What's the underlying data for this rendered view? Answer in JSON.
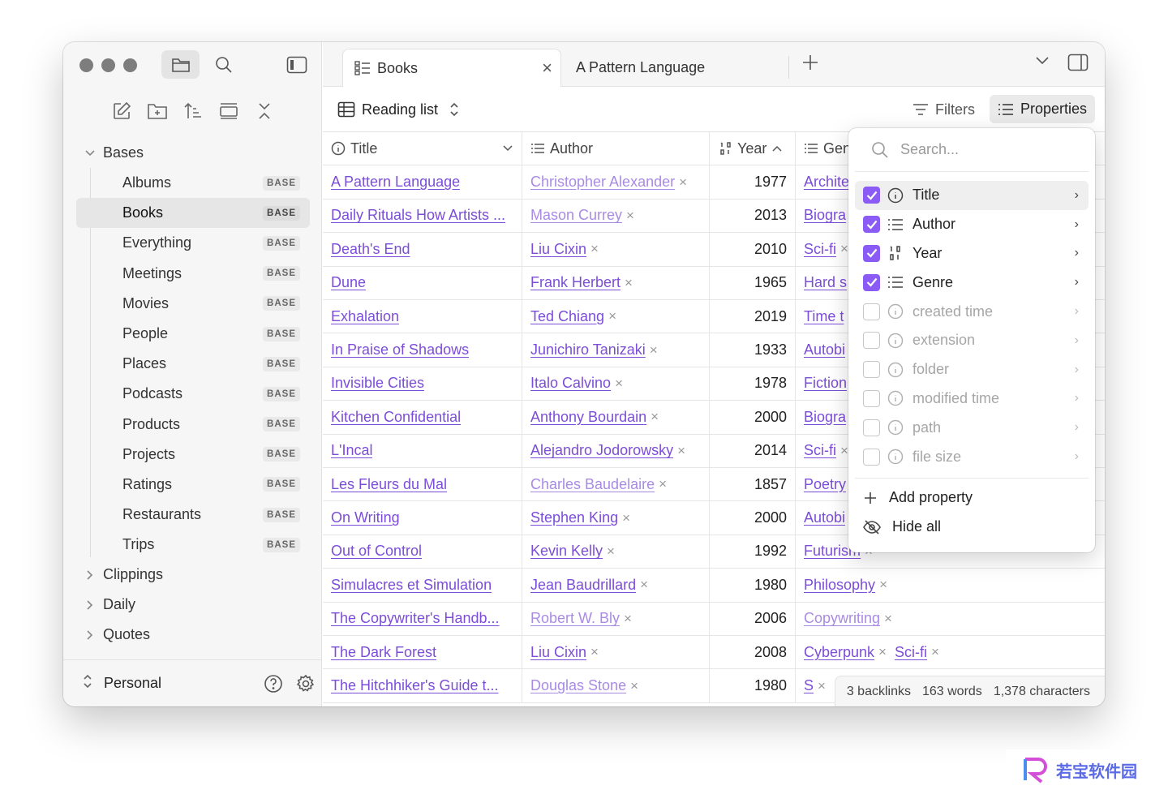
{
  "sidebar": {
    "tree": {
      "bases_label": "Bases",
      "bases": [
        {
          "label": "Albums",
          "badge": "BASE"
        },
        {
          "label": "Books",
          "badge": "BASE",
          "active": true
        },
        {
          "label": "Everything",
          "badge": "BASE"
        },
        {
          "label": "Meetings",
          "badge": "BASE"
        },
        {
          "label": "Movies",
          "badge": "BASE"
        },
        {
          "label": "People",
          "badge": "BASE"
        },
        {
          "label": "Places",
          "badge": "BASE"
        },
        {
          "label": "Podcasts",
          "badge": "BASE"
        },
        {
          "label": "Products",
          "badge": "BASE"
        },
        {
          "label": "Projects",
          "badge": "BASE"
        },
        {
          "label": "Ratings",
          "badge": "BASE"
        },
        {
          "label": "Restaurants",
          "badge": "BASE"
        },
        {
          "label": "Trips",
          "badge": "BASE"
        }
      ],
      "folders": [
        "Clippings",
        "Daily",
        "Quotes"
      ]
    },
    "vault_name": "Personal"
  },
  "tabs": [
    {
      "label": "Books",
      "active": true
    },
    {
      "label": "A Pattern Language",
      "active": false
    }
  ],
  "view": {
    "name": "Reading list",
    "filters_label": "Filters",
    "properties_label": "Properties"
  },
  "table": {
    "columns": [
      "Title",
      "Author",
      "Year",
      "Gen"
    ],
    "rows": [
      {
        "title": "A Pattern Language",
        "author": "Christopher Alexander",
        "author_faded": true,
        "year": "1977",
        "genre": "Archite"
      },
      {
        "title": "Daily Rituals How Artists ...",
        "author": "Mason Currey",
        "author_faded": true,
        "year": "2013",
        "genre": "Biogra"
      },
      {
        "title": "Death's End",
        "author": "Liu Cixin",
        "author_faded": false,
        "year": "2010",
        "genre": "Sci-fi"
      },
      {
        "title": "Dune",
        "author": "Frank Herbert",
        "author_faded": false,
        "year": "1965",
        "genre": "Hard s"
      },
      {
        "title": "Exhalation",
        "author": "Ted Chiang",
        "author_faded": false,
        "year": "2019",
        "genre": "Time t"
      },
      {
        "title": "In Praise of Shadows",
        "author": "Junichiro Tanizaki",
        "author_faded": false,
        "year": "1933",
        "genre": "Autobi"
      },
      {
        "title": "Invisible Cities",
        "author": "Italo Calvino",
        "author_faded": false,
        "year": "1978",
        "genre": "Fiction"
      },
      {
        "title": "Kitchen Confidential",
        "author": "Anthony Bourdain",
        "author_faded": false,
        "year": "2000",
        "genre": "Biogra"
      },
      {
        "title": "L'Incal",
        "author": "Alejandro Jodorowsky",
        "author_faded": false,
        "year": "2014",
        "genre": "Sci-fi"
      },
      {
        "title": "Les Fleurs du Mal",
        "author": "Charles Baudelaire",
        "author_faded": true,
        "year": "1857",
        "genre": "Poetry"
      },
      {
        "title": "On Writing",
        "author": "Stephen King",
        "author_faded": false,
        "year": "2000",
        "genre": "Autobi"
      },
      {
        "title": "Out of Control",
        "author": "Kevin Kelly",
        "author_faded": false,
        "year": "1992",
        "genre": "Futurism"
      },
      {
        "title": "Simulacres et Simulation",
        "author": "Jean Baudrillard",
        "author_faded": false,
        "year": "1980",
        "genre": "Philosophy"
      },
      {
        "title": "The Copywriter's Handb...",
        "author": "Robert W. Bly",
        "author_faded": true,
        "year": "2006",
        "genre": "Copywriting",
        "genre_faded": true
      },
      {
        "title": "The Dark Forest",
        "author": "Liu Cixin",
        "author_faded": false,
        "year": "2008",
        "genre": "Cyberpunk",
        "genre2": "Sci-fi"
      },
      {
        "title": "The Hitchhiker's Guide t...",
        "author": "Douglas Stone",
        "author_faded": true,
        "year": "1980",
        "genre": "S"
      }
    ]
  },
  "properties_popup": {
    "search_placeholder": "Search...",
    "items": [
      {
        "label": "Title",
        "checked": true,
        "icon": "info-icon"
      },
      {
        "label": "Author",
        "checked": true,
        "icon": "list-icon"
      },
      {
        "label": "Year",
        "checked": true,
        "icon": "number-icon"
      },
      {
        "label": "Genre",
        "checked": true,
        "icon": "list-icon"
      },
      {
        "label": "created time",
        "checked": false,
        "icon": "info-icon"
      },
      {
        "label": "extension",
        "checked": false,
        "icon": "info-icon"
      },
      {
        "label": "folder",
        "checked": false,
        "icon": "info-icon"
      },
      {
        "label": "modified time",
        "checked": false,
        "icon": "info-icon"
      },
      {
        "label": "path",
        "checked": false,
        "icon": "info-icon"
      },
      {
        "label": "file size",
        "checked": false,
        "icon": "info-icon"
      }
    ],
    "add_label": "Add property",
    "hide_label": "Hide all"
  },
  "status_bar": {
    "backlinks": "3 backlinks",
    "words": "163 words",
    "characters": "1,378 characters"
  },
  "watermark": {
    "text": "若宝软件园"
  }
}
